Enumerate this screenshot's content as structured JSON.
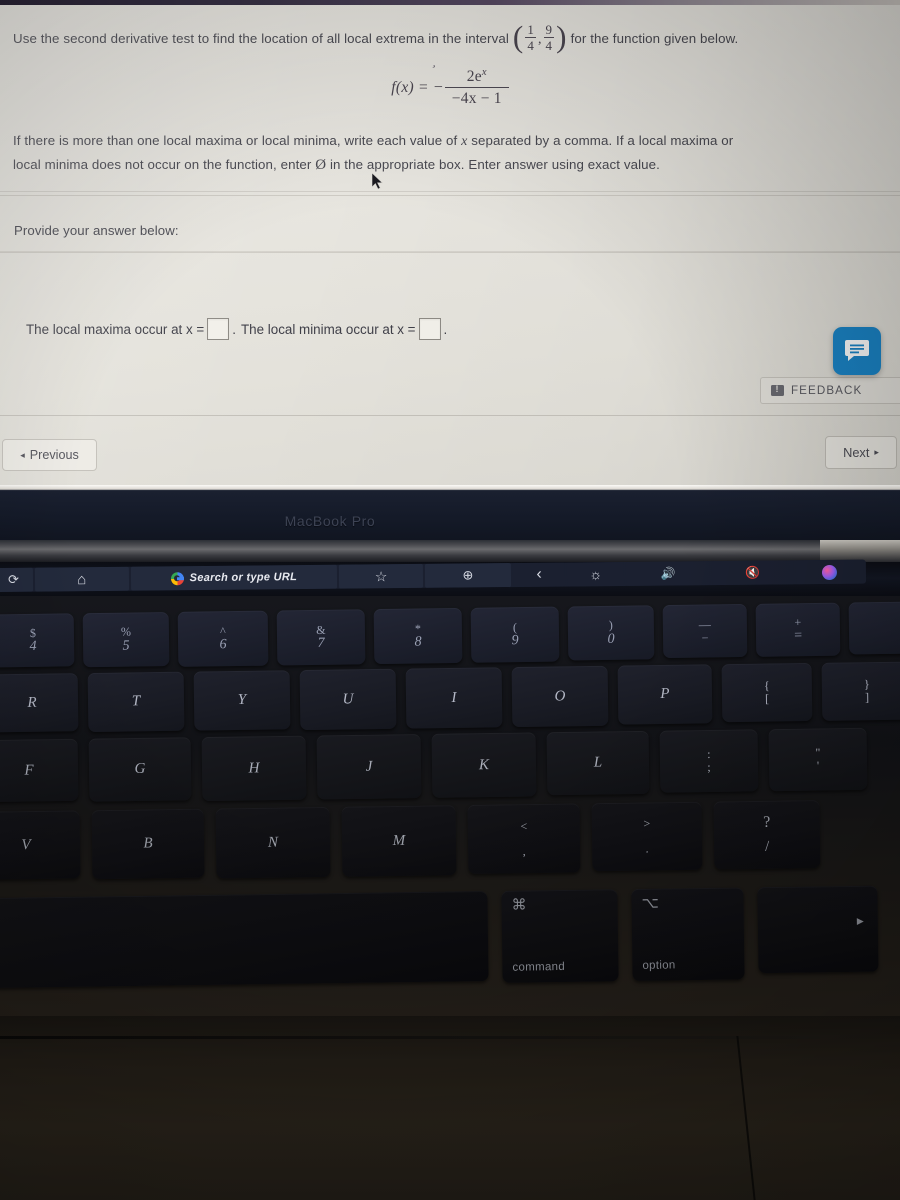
{
  "screen": {
    "question": {
      "prompt_before": "Use the second derivative test to find the location of all local extrema in the interval",
      "interval": {
        "left_num": "1",
        "left_den": "4",
        "right_num": "9",
        "right_den": "4",
        "separator": ","
      },
      "prompt_after": "for the function given below.",
      "formula": {
        "lhs": "f(x)",
        "equals": "=",
        "sign": "−",
        "numerator": "2e",
        "numerator_exponent": "x",
        "denominator": "−4x − 1"
      },
      "instructions_line1": "If there is more than one local maxima or local minima, write each value of",
      "instructions_var": "x",
      "instructions_line1b": "separated by a comma. If a local maxima or",
      "instructions_line2a": "local minima does not occur on the function, enter",
      "instructions_empty_symbol": "Ø",
      "instructions_line2b": "in the appropriate box. Enter answer using exact value."
    },
    "provide_label": "Provide your answer below:",
    "answer": {
      "maxima_label": "The local maxima occur at x =",
      "maxima_value": "",
      "maxima_period": ".",
      "minima_label": "The local minima occur at x =",
      "minima_value": "",
      "minima_period": "."
    },
    "feedback": {
      "label": "FEEDBACK",
      "icon": "speech-bubble-icon",
      "accent_color": "#1b86c9"
    },
    "nav": {
      "previous_label": "Previous",
      "previous_arrow": "◂",
      "next_label": "Next",
      "next_arrow": "▸"
    }
  },
  "laptop": {
    "brand": "MacBook Pro",
    "touchbar": {
      "refresh": "⟳",
      "home": "⌂",
      "google_glyph": "G",
      "url_placeholder": "Search or type URL",
      "bookmark": "☆",
      "new_tab": "⊕",
      "back": "‹",
      "brightness": "☼",
      "volume": "🔊",
      "mute": "🔇",
      "siri": "siri-icon"
    },
    "keyboard": {
      "row_numbers": [
        {
          "top": "$",
          "bottom": "4"
        },
        {
          "top": "%",
          "bottom": "5"
        },
        {
          "top": "^",
          "bottom": "6"
        },
        {
          "top": "&",
          "bottom": "7"
        },
        {
          "top": "*",
          "bottom": "8"
        },
        {
          "top": "(",
          "bottom": "9"
        },
        {
          "top": ")",
          "bottom": "0"
        },
        {
          "top": "—",
          "bottom": "–"
        },
        {
          "top": "+",
          "bottom": "="
        }
      ],
      "row_top": [
        "R",
        "T",
        "Y",
        "U",
        "I",
        "O",
        "P",
        "{",
        "}"
      ],
      "row_top_sub": [
        "",
        "",
        "",
        "",
        "",
        "",
        "",
        "[",
        "]"
      ],
      "row_home": [
        "F",
        "G",
        "H",
        "J",
        "K",
        "L",
        ":",
        "\""
      ],
      "row_home_sub": [
        "",
        "",
        "",
        "",
        "",
        "",
        ";",
        "'"
      ],
      "row_bottom": [
        "V",
        "B",
        "N",
        "M",
        "<",
        ">",
        "?"
      ],
      "row_bottom_sub": [
        "",
        "",
        "",
        "",
        ",",
        ".",
        "/"
      ],
      "modifiers": [
        {
          "symbol": "⌘",
          "name": "command"
        },
        {
          "symbol": "⌥",
          "name": "option"
        }
      ]
    }
  }
}
